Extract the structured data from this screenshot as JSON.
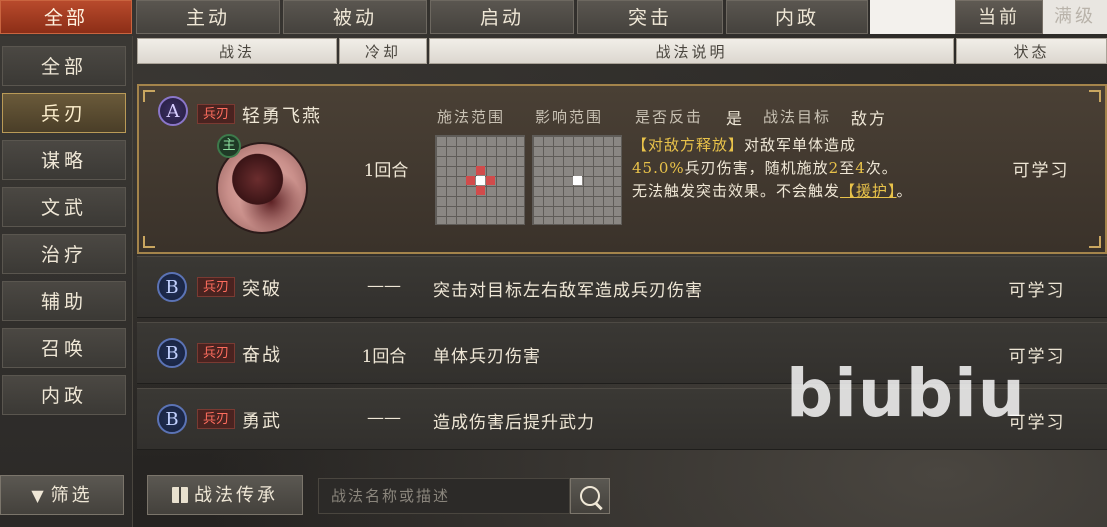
{
  "top_tabs": [
    "全部",
    "主动",
    "被动",
    "启动",
    "突击",
    "内政"
  ],
  "top_tabs_active": 0,
  "level_toggle": {
    "current": "当前",
    "max": "满级"
  },
  "sidebar": {
    "items": [
      "全部",
      "兵刃",
      "谋略",
      "文武",
      "治疗",
      "辅助",
      "召唤",
      "内政"
    ],
    "active": 1,
    "filter_label": "筛选"
  },
  "columns": {
    "skill": "战法",
    "cooldown": "冷却",
    "description": "战法说明",
    "status": "状态"
  },
  "skills": [
    {
      "grade": "A",
      "type": "兵刃",
      "name": "轻勇飞燕",
      "cooldown": "1回合",
      "status": "可学习",
      "main_badge": "主",
      "range_label": "施法范围",
      "effect_label": "影响范围",
      "counter_label": "是否反击",
      "counter_value": "是",
      "target_label": "战法目标",
      "target_value": "敌方",
      "desc_1": "【对敌方释放】",
      "desc_2": "对敌军单体造成",
      "desc_3": "45.0%",
      "desc_4": "兵刃伤害，随机施放",
      "desc_5": "2",
      "desc_6": "至",
      "desc_7": "4",
      "desc_8": "次。",
      "desc_9": "无法触发突击效果。不会触发",
      "desc_10": "【援护】",
      "desc_11": "。"
    },
    {
      "grade": "B",
      "type": "兵刃",
      "name": "突破",
      "cooldown": "——",
      "description": "突击对目标左右敌军造成兵刃伤害",
      "status": "可学习"
    },
    {
      "grade": "B",
      "type": "兵刃",
      "name": "奋战",
      "cooldown": "1回合",
      "description": "单体兵刃伤害",
      "status": "可学习"
    },
    {
      "grade": "B",
      "type": "兵刃",
      "name": "勇武",
      "cooldown": "——",
      "description": "造成伤害后提升武力",
      "status": "可学习"
    }
  ],
  "bottom": {
    "inherit_label": "战法传承",
    "search_placeholder": "战法名称或描述"
  },
  "watermark": "biubiu",
  "colors": {
    "accent_red": "#8c2e17",
    "gold": "#a4844b",
    "highlight_yellow": "#e8c24a",
    "type_tag_red": "#ff6d5e"
  }
}
